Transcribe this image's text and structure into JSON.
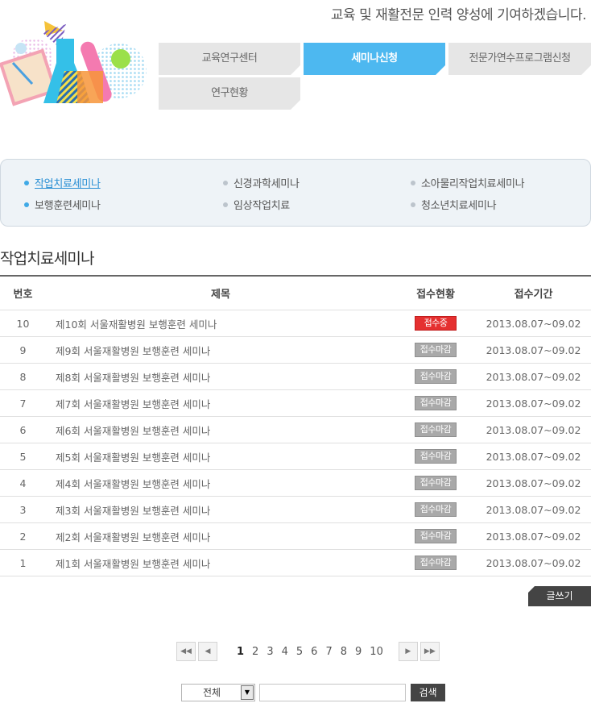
{
  "header": {
    "tagline": "교육 및 재활전문 인력 양성에 기여하겠습니다."
  },
  "main_nav": {
    "items": [
      {
        "label": "교육연구센터"
      },
      {
        "label": "세미나신청"
      },
      {
        "label": "전문가연수프로그램신청"
      },
      {
        "label": "연구현황"
      }
    ],
    "active_index": 1
  },
  "sub_nav": {
    "items": [
      {
        "label": "작업치료세미나"
      },
      {
        "label": "신경과학세미나"
      },
      {
        "label": "소아물리작업치료세미나"
      },
      {
        "label": "보행훈련세미나"
      },
      {
        "label": "임상작업치료"
      },
      {
        "label": "청소년치료세미나"
      }
    ],
    "active_index": 0
  },
  "section_title": "작업치료세미나",
  "board": {
    "headers": {
      "num": "번호",
      "title": "제목",
      "status": "접수현황",
      "period": "접수기간"
    },
    "rows": [
      {
        "num": "10",
        "title": "제10회 서울재활병원 보행훈련 세미나",
        "status": "접수중",
        "period": "2013.08.07~09.02"
      },
      {
        "num": "9",
        "title": "제9회 서울재활병원 보행훈련 세미나",
        "status": "접수마감",
        "period": "2013.08.07~09.02"
      },
      {
        "num": "8",
        "title": "제8회 서울재활병원 보행훈련 세미나",
        "status": "접수마감",
        "period": "2013.08.07~09.02"
      },
      {
        "num": "7",
        "title": "제7회 서울재활병원 보행훈련 세미나",
        "status": "접수마감",
        "period": "2013.08.07~09.02"
      },
      {
        "num": "6",
        "title": "제6회 서울재활병원 보행훈련 세미나",
        "status": "접수마감",
        "period": "2013.08.07~09.02"
      },
      {
        "num": "5",
        "title": "제5회 서울재활병원 보행훈련 세미나",
        "status": "접수마감",
        "period": "2013.08.07~09.02"
      },
      {
        "num": "4",
        "title": "제4회 서울재활병원 보행훈련 세미나",
        "status": "접수마감",
        "period": "2013.08.07~09.02"
      },
      {
        "num": "3",
        "title": "제3회 서울재활병원 보행훈련 세미나",
        "status": "접수마감",
        "period": "2013.08.07~09.02"
      },
      {
        "num": "2",
        "title": "제2회 서울재활병원 보행훈련 세미나",
        "status": "접수마감",
        "period": "2013.08.07~09.02"
      },
      {
        "num": "1",
        "title": "제1회 서울재활병원 보행훈련 세미나",
        "status": "접수마감",
        "period": "2013.08.07~09.02"
      }
    ]
  },
  "write_button": "글쓰기",
  "pagination": {
    "first_icon": "double-chevron-left-icon",
    "prev_icon": "chevron-left-icon",
    "next_icon": "chevron-right-icon",
    "last_icon": "double-chevron-right-icon",
    "pages": [
      "1",
      "2",
      "3",
      "4",
      "5",
      "6",
      "7",
      "8",
      "9",
      "10"
    ],
    "current": "1"
  },
  "search": {
    "select_value": "전체",
    "input_value": "",
    "button_label": "검색"
  },
  "colors": {
    "accent_blue": "#4db8f0",
    "status_open": "#e53030",
    "status_closed": "#a9a9a9",
    "dark_button": "#444444"
  }
}
